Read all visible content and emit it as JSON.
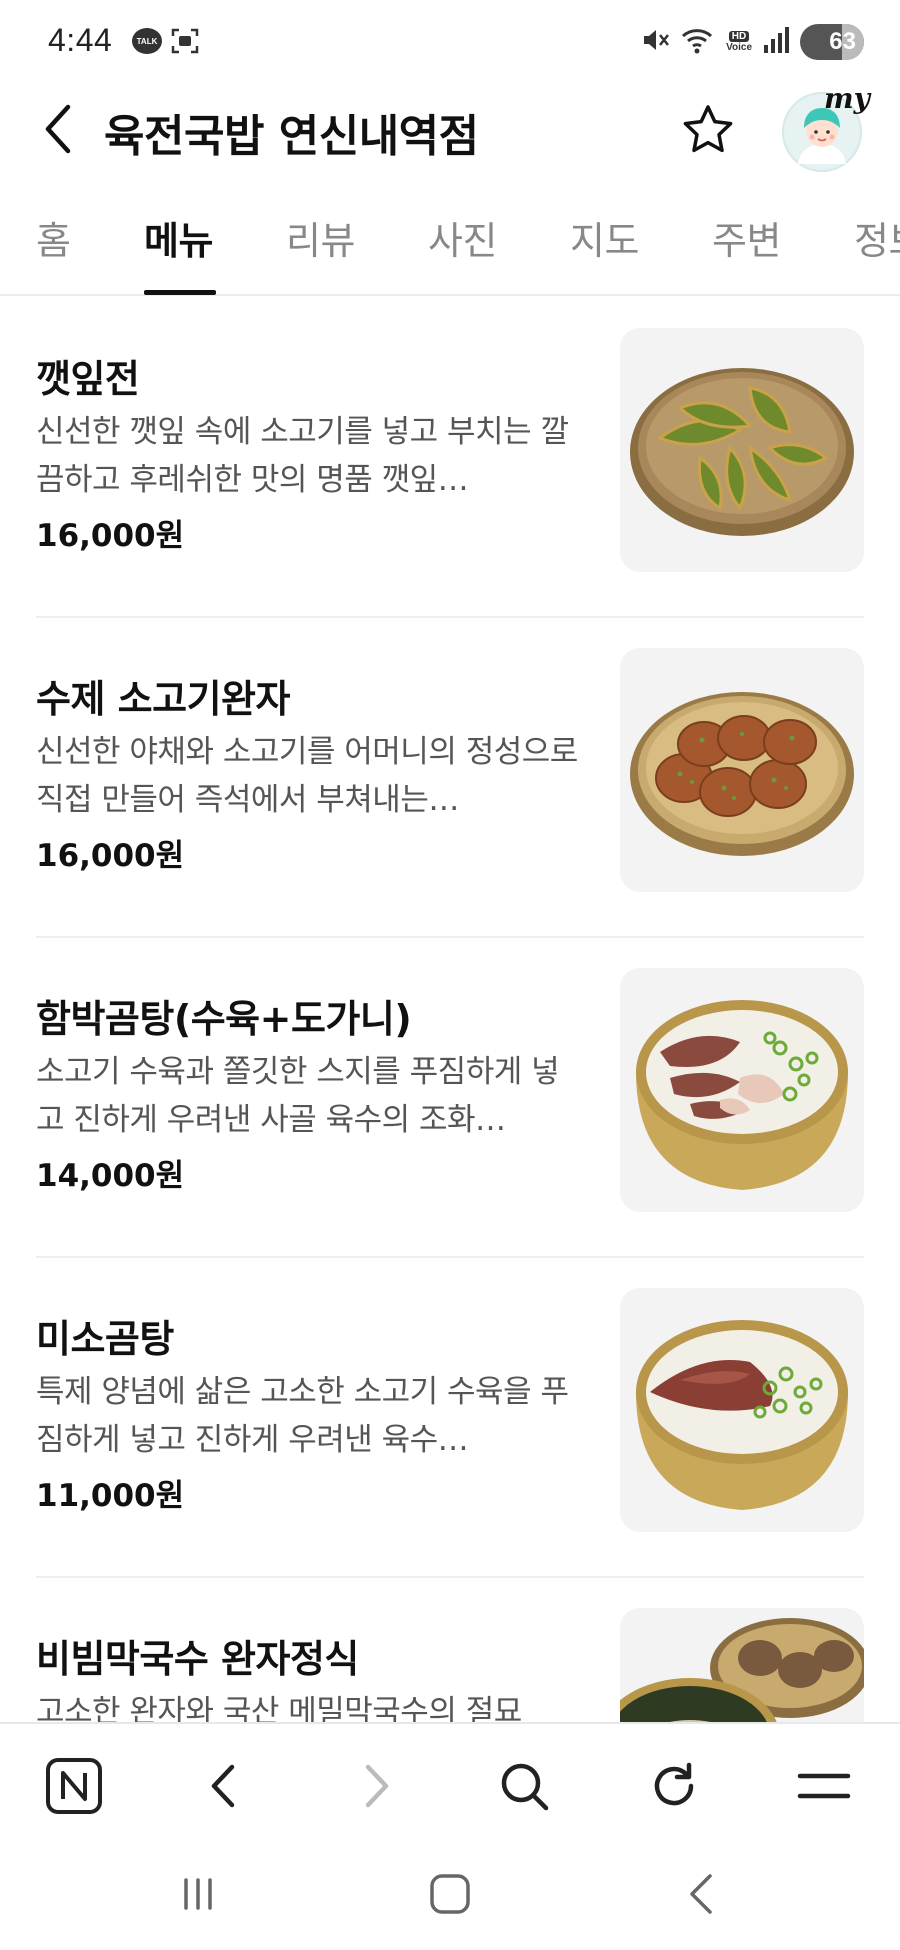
{
  "status_bar": {
    "time": "4:44",
    "talk_badge": "TALK",
    "hd_label": "HD",
    "voice_label": "Voice",
    "battery_level": "63"
  },
  "header": {
    "title": "육전국밥 연신내역점",
    "avatar_label": "my"
  },
  "tabs": [
    {
      "label": "홈",
      "active": false
    },
    {
      "label": "메뉴",
      "active": true
    },
    {
      "label": "리뷰",
      "active": false
    },
    {
      "label": "사진",
      "active": false
    },
    {
      "label": "지도",
      "active": false
    },
    {
      "label": "주변",
      "active": false
    },
    {
      "label": "정보",
      "active": false
    }
  ],
  "menu_items": [
    {
      "name": "깻잎전",
      "description": "신선한 깻잎 속에 소고기를 넣고 부치는 깔끔하고 후레쉬한 맛의 명품 깻잎…",
      "price": "16,000원",
      "image": "perilla-leaf-pancake"
    },
    {
      "name": "수제 소고기완자",
      "description": "신선한 야채와 소고기를 어머니의 정성으로 직접 만들어 즉석에서 부쳐내는…",
      "price": "16,000원",
      "image": "beef-meatball-patties"
    },
    {
      "name": "함박곰탕(수육+도가니)",
      "description": "소고기 수육과 쫄깃한 스지를 푸짐하게 넣고 진하게 우려낸 사골 육수의 조화…",
      "price": "14,000원",
      "image": "beef-bone-soup-with-tendon"
    },
    {
      "name": "미소곰탕",
      "description": "특제 양념에 삶은 고소한 소고기 수육을 푸짐하게 넣고 진하게 우려낸 육수…",
      "price": "11,000원",
      "image": "beef-bone-soup"
    },
    {
      "name": "비빔막국수 완자정식",
      "description": "고소한 완자와 국산 메밀막국수의 절묘",
      "price": "",
      "image": "buckwheat-noodle-set"
    }
  ],
  "browser_bar": {
    "home_label": "N"
  },
  "colors": {
    "text_primary": "#111111",
    "text_secondary": "#555555",
    "tab_inactive": "#888888",
    "divider": "#efefef",
    "thumb_bg": "#f3f3f3",
    "brass": "#c9a85a"
  }
}
